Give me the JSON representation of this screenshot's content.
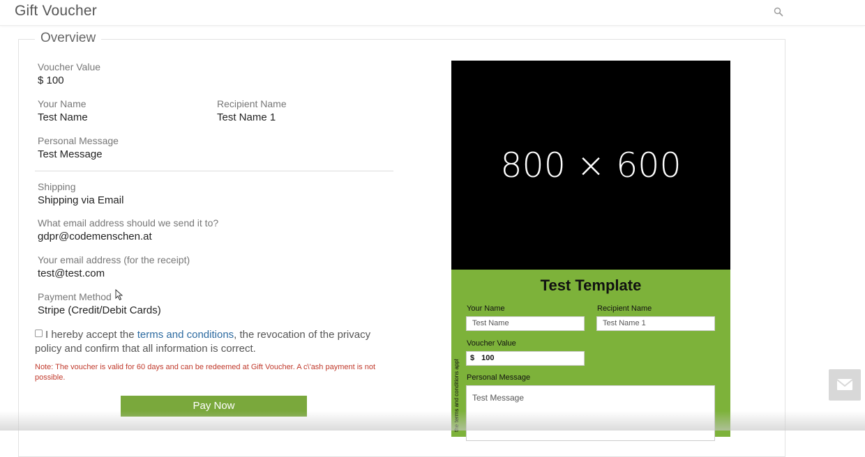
{
  "header": {
    "title": "Gift Voucher",
    "search_icon": "search-icon"
  },
  "overview": {
    "legend": "Overview",
    "voucher_value_label": "Voucher Value",
    "voucher_value": "$ 100",
    "your_name_label": "Your Name",
    "your_name": "Test Name",
    "recipient_name_label": "Recipient Name",
    "recipient_name": "Test Name 1",
    "personal_message_label": "Personal Message",
    "personal_message": "Test Message",
    "shipping_label": "Shipping",
    "shipping": "Shipping via Email",
    "send_email_label": "What email address should we send it to?",
    "send_email": "gdpr@codemenschen.at",
    "receipt_email_label": "Your email address (for the receipt)",
    "receipt_email": "test@test.com",
    "payment_method_label": "Payment Method",
    "payment_method": "Stripe (Credit/Debit Cards)"
  },
  "consent": {
    "prefix": "I hereby accept the ",
    "link": "terms and conditions",
    "suffix": ", the revocation of the privacy policy and confirm that all information is correct."
  },
  "note": "Note: The voucher is valid for 60 days and can be redeemed at Gift Voucher. A c\\'ash payment is not possible.",
  "pay_button": "Pay Now",
  "preview": {
    "image_text": "800 × 600",
    "template_title": "Test Template",
    "your_name_label": "Your Name",
    "your_name_value": "Test Name",
    "recipient_name_label": "Recipient Name",
    "recipient_name_value": "Test Name 1",
    "voucher_value_label": "Voucher Value",
    "voucher_currency": "$",
    "voucher_amount": "100",
    "personal_message_label": "Personal Message",
    "personal_message_value": "Test Message",
    "vertical_text": "the terms and conditions apply"
  },
  "colors": {
    "accent_green": "#7aa83c",
    "template_green": "#7db23a",
    "note_red": "#c0392b",
    "link_blue": "#2c6aa0"
  }
}
